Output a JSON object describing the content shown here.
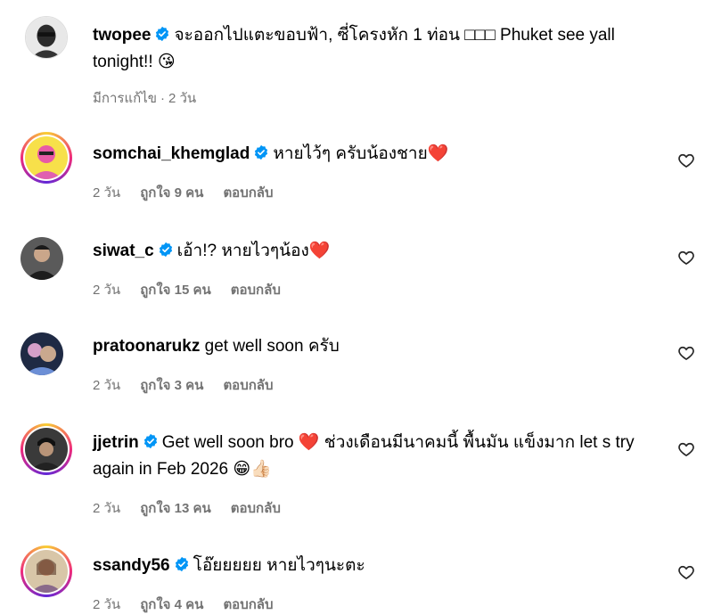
{
  "post": {
    "username": "twopee",
    "text": "จะออกไปแตะขอบฟ้า, ซี่โครงหัก 1 ท่อน □□□ Phuket see yall tonight!! 😘",
    "edited": "มีการแก้ไข",
    "time": "2 วัน"
  },
  "comments": [
    {
      "username": "somchai_khemglad",
      "verified": true,
      "text": "หายไว้ๆ ครับน้องชาย❤️",
      "time": "2 วัน",
      "likes": "ถูกใจ 9 คน",
      "reply": "ตอบกลับ"
    },
    {
      "username": "siwat_c",
      "verified": true,
      "text": "เอ้า!? หายไวๆน้อง❤️",
      "time": "2 วัน",
      "likes": "ถูกใจ 15 คน",
      "reply": "ตอบกลับ"
    },
    {
      "username": "pratoonarukz",
      "verified": false,
      "text": "get well soon ครับ",
      "time": "2 วัน",
      "likes": "ถูกใจ 3 คน",
      "reply": "ตอบกลับ"
    },
    {
      "username": "jjetrin",
      "verified": true,
      "text": "Get well soon bro ❤️ ช่วงเดือนมีนาคมนี้ พื้นมัน แข็งมาก let s try again in Feb 2026 😁👍🏻",
      "time": "2 วัน",
      "likes": "ถูกใจ 13 คน",
      "reply": "ตอบกลับ"
    },
    {
      "username": "ssandy56",
      "verified": true,
      "text": "โอ๊ยยยยย หายไวๆนะตะ",
      "time": "2 วัน",
      "likes": "ถูกใจ 4 คน",
      "reply": "ตอบกลับ"
    }
  ],
  "icons": {
    "verified": "verified-badge-icon",
    "like": "heart-icon"
  },
  "colors": {
    "verified": "#0095f6",
    "meta": "#737373",
    "ring_start": "#f9ce34",
    "ring_mid": "#ee2a7b",
    "ring_end": "#6228d7"
  }
}
